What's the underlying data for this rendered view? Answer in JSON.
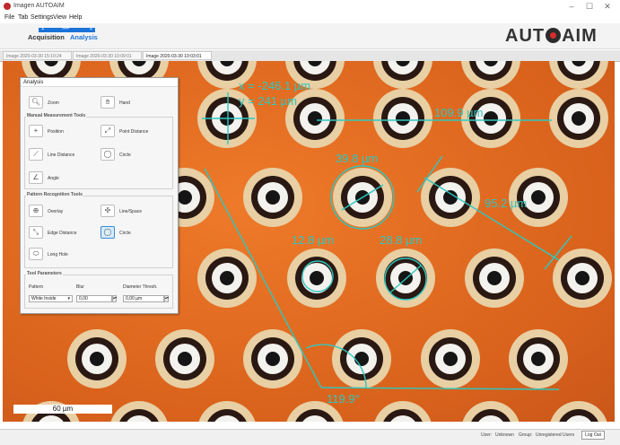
{
  "window": {
    "title": "Imagen AUTOAIM",
    "minimize_icon": "minimize-icon",
    "maximize_icon": "maximize-icon",
    "close_icon": "close-icon"
  },
  "menu": {
    "items": [
      "File",
      "Tab",
      "Settings",
      "View",
      "Help"
    ]
  },
  "wizard": {
    "steps": [
      {
        "number": "1",
        "label": "Acquisition"
      },
      {
        "number": "2",
        "label": "Analysis"
      }
    ],
    "step_arrows": ">>>"
  },
  "logo": {
    "text_before": "AUT",
    "text_after": "AIM"
  },
  "tabs": [
    {
      "label": "Image 2020-03-30 15:10:24",
      "active": false
    },
    {
      "label": "Image 2020-03-30 10:09:01",
      "active": false
    },
    {
      "label": "Image 2020-03-30 10:03:01",
      "active": true
    }
  ],
  "measurements": {
    "coordinates": {
      "x": "x = -246.1 µm",
      "y": "y = 241 µm"
    },
    "labels": [
      "109.9 µm",
      "39.8 µm",
      "95.2 µm",
      "12.8 µm",
      "28.8 µm",
      "119.9°"
    ]
  },
  "scale_bar": {
    "label": "60 µm"
  },
  "panel": {
    "title": "Analysis",
    "zoom": "Zoom",
    "hand": "Hand",
    "manual_section": "Manual Measurement Tools",
    "position": "Position",
    "point_distance": "Point Distance",
    "line_distance": "Line Distance",
    "circle": "Circle",
    "angle": "Angle",
    "pattern_section": "Pattern Recognition Tools",
    "overlay": "Overlay",
    "line_space": "Line/Space",
    "edge_distance": "Edge Distance",
    "circle2": "Circle",
    "long_hole": "Long Hole",
    "params_section": "Tool Parameters",
    "pattern_label": "Pattern",
    "blur_label": "Blur",
    "diameter_label": "Diameter Thresh.",
    "pattern_value": "White Inside",
    "blur_value": "0,00",
    "diameter_value": "0,00 µm"
  },
  "status": {
    "user": "User:",
    "user_value": "Unknown",
    "group": "Group:",
    "group_value": "Unregistered Users",
    "logout": "Log Out"
  },
  "colors": {
    "accent": "#1a73d9",
    "measure": "#2ec8c0",
    "sample": "#e06a22"
  }
}
